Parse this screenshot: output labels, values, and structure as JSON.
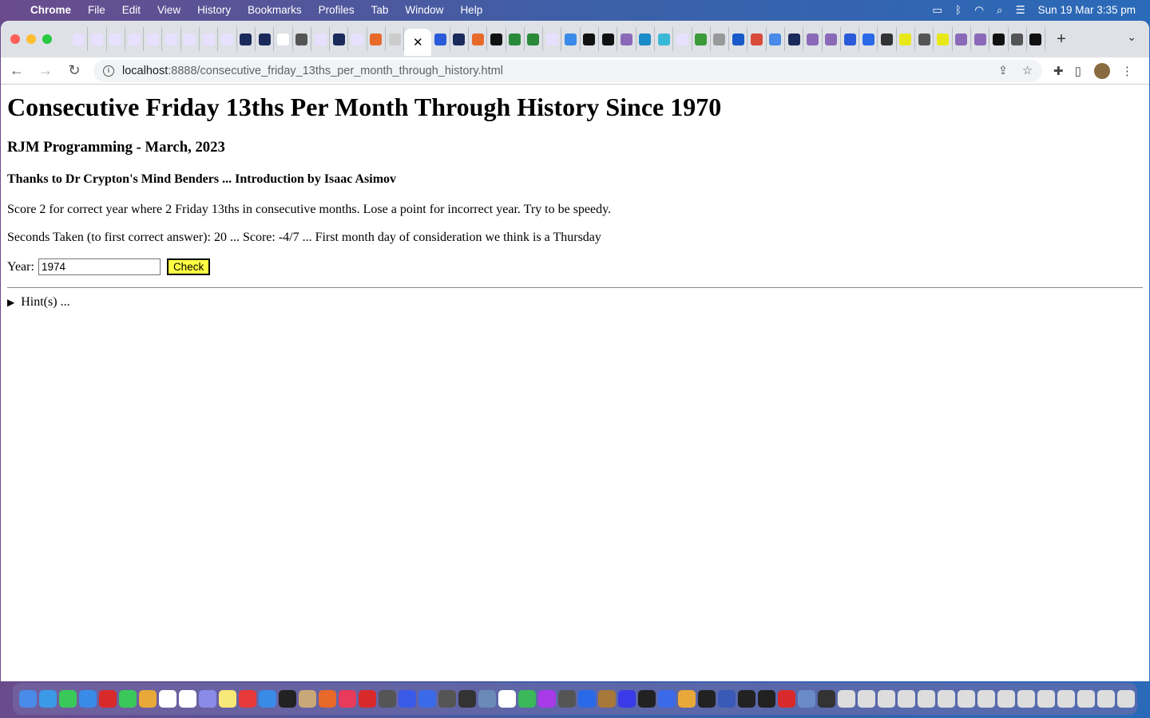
{
  "menubar": {
    "app": "Chrome",
    "items": [
      "File",
      "Edit",
      "View",
      "History",
      "Bookmarks",
      "Profiles",
      "Tab",
      "Window",
      "Help"
    ],
    "clock": "Sun 19 Mar  3:35 pm"
  },
  "tabs": {
    "favicon_colors": [
      "#e8e0ff",
      "#e8e0ff",
      "#e8e0ff",
      "#e8e0ff",
      "#e8e0ff",
      "#e8e0ff",
      "#e8e0ff",
      "#e8e0ff",
      "#e8e0ff",
      "#1a2a5a",
      "#1a2a5a",
      "#ffffff",
      "#555555",
      "#e8e0ff",
      "#1a2a5a",
      "#e8e0ff",
      "#e86a2a",
      "#cccccc",
      "#2a5ad8",
      "#1a2a5a",
      "#e86a2a",
      "#111111",
      "#2a8a3a",
      "#2a8a3a",
      "#e8e0ff",
      "#3a8ae8",
      "#111111",
      "#111111",
      "#8a6ab8",
      "#1a8ac8",
      "#3ab8d8",
      "#e8e0ff",
      "#3a9a3a",
      "#999999",
      "#1a5ac8",
      "#d84a3a",
      "#4a8ae8",
      "#1a2a5a",
      "#8a6ab8",
      "#8a6ab8",
      "#2a5ad8",
      "#2a6ae8",
      "#333333",
      "#e8e818",
      "#555555",
      "#e8e818",
      "#8a6ab8",
      "#8a6ab8",
      "#111111",
      "#555555",
      "#111111"
    ],
    "active_close": "✕",
    "new_tab": "+"
  },
  "toolbar": {
    "url_host": "localhost",
    "url_path": ":8888/consecutive_friday_13ths_per_month_through_history.html"
  },
  "page": {
    "title": "Consecutive Friday 13ths Per Month Through History Since 1970",
    "subtitle": "RJM Programming - March, 2023",
    "credit": "Thanks to Dr Crypton's Mind Benders ... Introduction by Isaac Asimov",
    "instructions": "Score 2 for correct year where 2 Friday 13ths in consecutive months. Lose a point for incorrect year. Try to be speedy.",
    "status": "Seconds Taken (to first correct answer): 20 ... Score: -4/7 ... First month day of consideration we think is a Thursday",
    "year_label": "Year:",
    "year_value": "1974",
    "check_label": "Check",
    "hint_label": "Hint(s) ..."
  },
  "dock": {
    "colors": [
      "#4a8ae8",
      "#3a9ae8",
      "#3ac85a",
      "#3a8ae8",
      "#d82a2a",
      "#3ac85a",
      "#e8a83a",
      "#ffffff",
      "#ffffff",
      "#8a8ae8",
      "#f8e878",
      "#e83a3a",
      "#3a8ae8",
      "#222222",
      "#c8a878",
      "#e8682a",
      "#e83a5a",
      "#d82a2a",
      "#555555",
      "#3a5ae8",
      "#3a6ae8",
      "#555555",
      "#333333",
      "#6a8ab8",
      "#ffffff",
      "#3ab85a",
      "#a83ae8",
      "#555555",
      "#2a6ae8",
      "#a8783a",
      "#3a3ae8",
      "#222222",
      "#3a6ae8",
      "#e8a83a",
      "#222222",
      "#3a5ab8",
      "#222222",
      "#222222",
      "#d82a2a",
      "#6a8ac8",
      "#333333",
      "#dddddd",
      "#dddddd",
      "#dddddd",
      "#dddddd",
      "#dddddd",
      "#dddddd",
      "#dddddd",
      "#dddddd",
      "#dddddd",
      "#dddddd",
      "#dddddd",
      "#dddddd",
      "#dddddd",
      "#dddddd",
      "#dddddd"
    ]
  }
}
